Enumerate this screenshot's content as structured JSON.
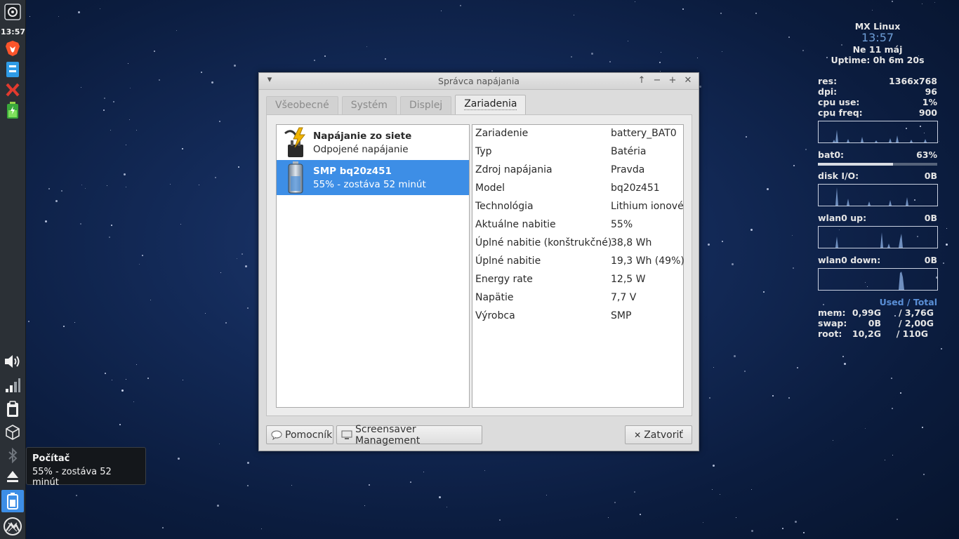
{
  "desktop": {
    "star_color": "#dfe8ff"
  },
  "panel": {
    "clock": "13:57",
    "launchers": [
      "menu-icon",
      "brave-browser-icon",
      "file-manager-icon",
      "dock-app-icon",
      "battery-app-icon"
    ],
    "tray": [
      "volume-icon",
      "network-icon",
      "clipboard-icon",
      "package-updater-icon",
      "bluetooth-icon",
      "eject-icon",
      "battery-icon",
      "mx-logo-icon"
    ]
  },
  "tooltip": {
    "title": "Počítač",
    "text": "55% - zostáva 52 minút"
  },
  "window": {
    "title": "Správca napájania",
    "tabs": [
      {
        "label": "Všeobecné",
        "active": false
      },
      {
        "label": "Systém",
        "active": false
      },
      {
        "label": "Displej",
        "active": false
      },
      {
        "label": "Zariadenia",
        "active": true
      }
    ],
    "devices": [
      {
        "name": "Napájanie zo siete",
        "sub": "Odpojené napájanie",
        "icon": "ac-plug-icon",
        "selected": false
      },
      {
        "name": "SMP bq20z451",
        "sub": "55% - zostáva 52 minút",
        "icon": "battery-icon",
        "selected": true
      }
    ],
    "properties": [
      {
        "key": "Zariadenie",
        "value": "battery_BAT0"
      },
      {
        "key": "Typ",
        "value": "Batéria"
      },
      {
        "key": "Zdroj napájania",
        "value": "Pravda"
      },
      {
        "key": "Model",
        "value": "bq20z451"
      },
      {
        "key": "Technológia",
        "value": "Lithium ionové"
      },
      {
        "key": "Aktuálne nabitie",
        "value": "55%"
      },
      {
        "key": "Úplné nabitie (konštrukčné)",
        "value": "38,8 Wh"
      },
      {
        "key": "Úplné nabitie",
        "value": "19,3 Wh (49%)"
      },
      {
        "key": "Energy rate",
        "value": "12,5 W"
      },
      {
        "key": "Napätie",
        "value": "7,7 V"
      },
      {
        "key": "Výrobca",
        "value": "SMP"
      }
    ],
    "buttons": {
      "help": "Pomocník",
      "screensaver": "Screensaver Management",
      "close": "Zatvoriť"
    },
    "selection_color": "#3d8ee6"
  },
  "conky": {
    "distro": "MX Linux",
    "time": "13:57",
    "date": "Ne 11 máj",
    "uptime": "Uptime: 0h 6m 20s",
    "res_label": "res:",
    "res_value": "1366x768",
    "dpi_label": "dpi:",
    "dpi_value": "96",
    "cpu_use_label": "cpu use:",
    "cpu_use_value": "1%",
    "cpu_freq_label": "cpu freq:",
    "cpu_freq_value": "900",
    "bat_label": "bat0:",
    "bat_value": "63%",
    "bat_level": 0.63,
    "disk_label": "disk I/O:",
    "disk_value": "0B",
    "wlan_up_label": "wlan0 up:",
    "wlan_up_value": "0B",
    "wlan_down_label": "wlan0 down:",
    "wlan_down_value": "0B",
    "mem_header": "Used / Total",
    "mem_label": "mem:",
    "mem_used": "0,99G",
    "mem_total": "/ 3,76G",
    "swap_label": "swap:",
    "swap_used": "0B",
    "swap_total": "/ 2,00G",
    "root_label": "root:",
    "root_used": "10,2G",
    "root_total": "/ 110G",
    "time_color": "#6f9fd8",
    "header_color": "#5a8fd6"
  }
}
